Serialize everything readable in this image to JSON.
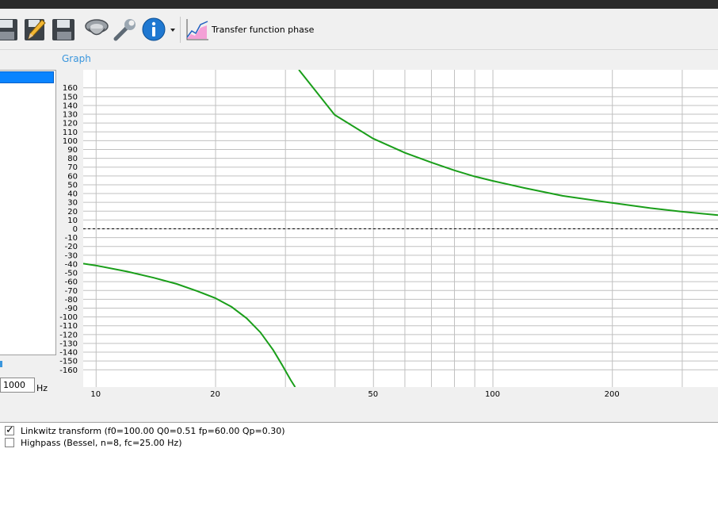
{
  "toolbar": {
    "icons": [
      "save-icon",
      "edit-icon",
      "save-as-icon",
      "driver-icon",
      "settings-wrench-icon",
      "info-icon",
      "dropdown-arrow-icon",
      "transfer-function-chart-icon"
    ],
    "view_label": "Transfer function phase"
  },
  "graph": {
    "label": "Graph"
  },
  "frequency": {
    "value": "1000",
    "unit": "Hz"
  },
  "legend": {
    "items": [
      {
        "label": "Linkwitz transform (f0=100.00 Q0=0.51 fp=60.00 Qp=0.30)",
        "checked": true
      },
      {
        "label": "Highpass (Bessel, n=8, fc=25.00 Hz)",
        "checked": false
      }
    ]
  },
  "colors": {
    "curve": "#1a9e1a",
    "accent": "#3a96dd",
    "grid": "#c0c0c0"
  },
  "chart_data": {
    "type": "line",
    "x_scale": "log",
    "xlim": [
      9.3,
      370
    ],
    "ylim": [
      -180,
      180
    ],
    "x_ticks": [
      10,
      20,
      50,
      100,
      200
    ],
    "y_ticks": [
      160,
      150,
      140,
      130,
      120,
      110,
      100,
      90,
      80,
      70,
      60,
      50,
      40,
      30,
      20,
      10,
      0,
      -10,
      -20,
      -30,
      -40,
      -50,
      -60,
      -70,
      -80,
      -90,
      -100,
      -110,
      -120,
      -130,
      -140,
      -150,
      -160
    ],
    "grid": true,
    "reference_line": 0,
    "series": [
      {
        "x": [
          9.3,
          10,
          12,
          14,
          16,
          18,
          20,
          22,
          24,
          26,
          28,
          29.5,
          31,
          31.8,
          32.5,
          40,
          50,
          60,
          70,
          80,
          90,
          100,
          120,
          150,
          200,
          250,
          300,
          370
        ],
        "y": [
          -40,
          -42,
          -49,
          -56,
          -63,
          -71,
          -79,
          -89,
          -102,
          -118,
          -138,
          -155,
          -172,
          -180,
          180,
          129,
          102,
          86,
          75,
          66,
          59,
          54,
          46,
          37,
          29,
          23,
          19,
          15
        ]
      }
    ]
  }
}
